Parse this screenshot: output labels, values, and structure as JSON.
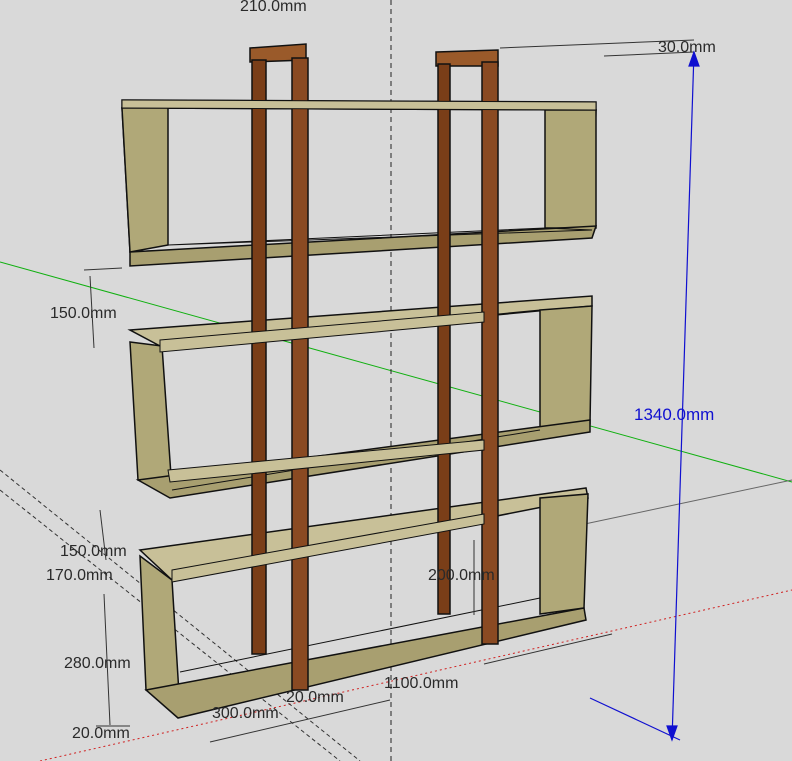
{
  "dimensions": {
    "top_width": "210.0mm",
    "post_depth": "30.0mm",
    "total_height": "1340.0mm",
    "gap_upper": "150.0mm",
    "gap_lower": "150.0mm",
    "shelf_offset": "170.0mm",
    "inner_height_mid": "200.0mm",
    "bottom_box_height": "280.0mm",
    "total_width": "1100.0mm",
    "depth": "300.0mm",
    "overlap_label": "20.0mm",
    "base_thickness": "20.0mm"
  },
  "colors": {
    "background": "#d9d9d9",
    "wood_face": "#b0a878",
    "wood_side": "#8e8a62",
    "post": "#8a4a22",
    "post_dark": "#5e2f12",
    "axis_green": "#10b010",
    "axis_red": "#d02020",
    "dim_blue": "#1010d0"
  }
}
